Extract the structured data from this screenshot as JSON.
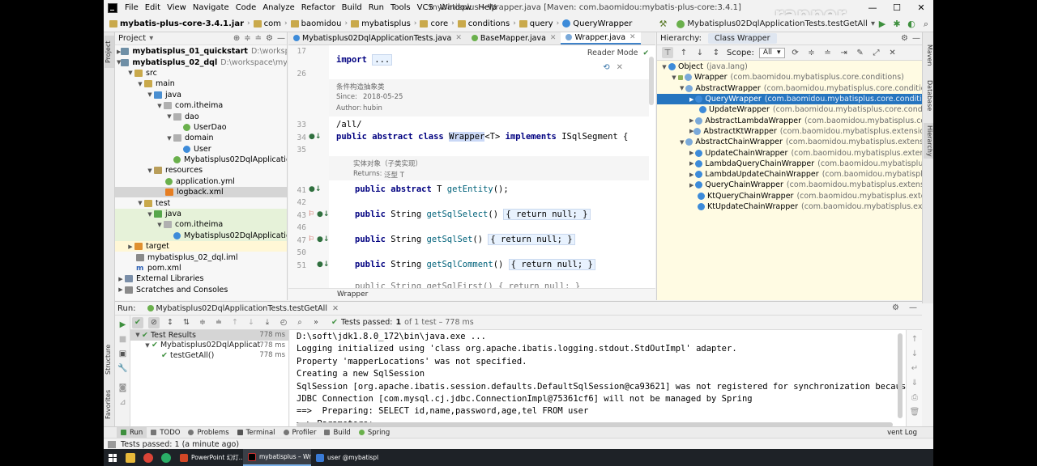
{
  "window": {
    "title": "mybatisplus – Wrapper.java [Maven: com.baomidou:mybatis-plus-core:3.4.1]",
    "watermark": "rapper"
  },
  "menu": [
    "File",
    "Edit",
    "View",
    "Navigate",
    "Code",
    "Analyze",
    "Refactor",
    "Build",
    "Run",
    "Tools",
    "VCS",
    "Window",
    "Help"
  ],
  "breadcrumbs": [
    "mybatis-plus-core-3.4.1.jar",
    "com",
    "baomidou",
    "mybatisplus",
    "core",
    "conditions",
    "query",
    "QueryWrapper"
  ],
  "run_config": "Mybatisplus02DqlApplicationTests.testGetAll",
  "project": {
    "title": "Project",
    "rows": [
      {
        "label": "mybatisplus_01_quickstart",
        "path": "D:\\workspace\\m",
        "bold": true
      },
      {
        "label": "mybatisplus_02_dql",
        "path": "D:\\workspace\\mybatisp",
        "bold": true
      },
      {
        "label": "src"
      },
      {
        "label": "main"
      },
      {
        "label": "java"
      },
      {
        "label": "com.itheima"
      },
      {
        "label": "dao"
      },
      {
        "label": "UserDao"
      },
      {
        "label": "domain"
      },
      {
        "label": "User"
      },
      {
        "label": "Mybatisplus02DqlApplication"
      },
      {
        "label": "resources"
      },
      {
        "label": "application.yml"
      },
      {
        "label": "logback.xml"
      },
      {
        "label": "test"
      },
      {
        "label": "java"
      },
      {
        "label": "com.itheima"
      },
      {
        "label": "Mybatisplus02DqlApplicationTe"
      },
      {
        "label": "target"
      },
      {
        "label": "mybatisplus_02_dql.iml"
      },
      {
        "label": "pom.xml"
      },
      {
        "label": "External Libraries"
      },
      {
        "label": "Scratches and Consoles"
      }
    ]
  },
  "editor": {
    "tabs": [
      "Mybatisplus02DqlApplicationTests.java",
      "BaseMapper.java",
      "Wrapper.java"
    ],
    "reader_mode": "Reader Mode",
    "footer": "Wrapper",
    "line_numbers": [
      "17",
      "26",
      "33",
      "34",
      "35",
      "41",
      "42",
      "43",
      "46",
      "47",
      "50",
      "51"
    ],
    "doc": {
      "title": "条件构造抽象类",
      "since_label": "Since:",
      "since": "2018-05-25",
      "author_label": "Author:",
      "author": "hubin",
      "entity_title": "实体对象（子类实现）",
      "returns_label": "Returns:",
      "returns": "泛型 T"
    },
    "code": {
      "import_kw": "import",
      "import_fold": "...",
      "all_comment": "/all/",
      "class_prefix_kw": "public abstract class",
      "class_name": "Wrapper",
      "class_suffix": "<T> ",
      "implements_kw": "implements",
      "class_end": " ISqlSegment {",
      "l41_kw": "public abstract",
      "l41_rest": " T ",
      "l41_fn": "getEntity",
      "l41_end": "();",
      "l43_kw": "public",
      "l43_type": " String ",
      "l43_fn": "getSqlSelect",
      "l43_paren": "() ",
      "l43_fold": "{ return null; }",
      "l47_kw": "public",
      "l47_type": " String ",
      "l47_fn": "getSqlSet",
      "l47_paren": "() ",
      "l47_fold": "{ return null; }",
      "l51_kw": "public",
      "l51_type": " String ",
      "l51_fn": "getSqlComment",
      "l51_paren": "() ",
      "l51_fold": "{ return null; }",
      "l55_partial": "public String getSqlFirst() { return null; }"
    }
  },
  "hierarchy": {
    "title": "Hierarchy:",
    "tab": "Class Wrapper",
    "scope_label": "Scope:",
    "scope_value": "All",
    "rows": [
      {
        "name": "Object",
        "pkg": "(java.lang)"
      },
      {
        "name": "Wrapper",
        "pkg": "(com.baomidou.mybatisplus.core.conditions)"
      },
      {
        "name": "AbstractWrapper",
        "pkg": "(com.baomidou.mybatisplus.core.conditions)"
      },
      {
        "name": "QueryWrapper",
        "pkg": "(com.baomidou.mybatisplus.core.conditions.qu"
      },
      {
        "name": "UpdateWrapper",
        "pkg": "(com.baomidou.mybatisplus.core.conditions.u"
      },
      {
        "name": "AbstractLambdaWrapper",
        "pkg": "(com.baomidou.mybatisplus.core.condit"
      },
      {
        "name": "AbstractKtWrapper",
        "pkg": "(com.baomidou.mybatisplus.extension.kotlin"
      },
      {
        "name": "AbstractChainWrapper",
        "pkg": "(com.baomidou.mybatisplus.extension.co"
      },
      {
        "name": "UpdateChainWrapper",
        "pkg": "(com.baomidou.mybatisplus.extension.c"
      },
      {
        "name": "LambdaQueryChainWrapper",
        "pkg": "(com.baomidou.mybatisplus.exte"
      },
      {
        "name": "LambdaUpdateChainWrapper",
        "pkg": "(com.baomidou.mybatisplus.ext"
      },
      {
        "name": "QueryChainWrapper",
        "pkg": "(com.baomidou.mybatisplus.extension.co"
      },
      {
        "name": "KtQueryChainWrapper",
        "pkg": "(com.baomidou.mybatisplus.extension.ko"
      },
      {
        "name": "KtUpdateChainWrapper",
        "pkg": "(com.baomidou.mybatisplus.extension.k"
      }
    ]
  },
  "run": {
    "label": "Run:",
    "tab": "Mybatisplus02DqlApplicationTests.testGetAll",
    "status_prefix": "Tests passed:",
    "status_count": "1",
    "status_suffix": "of 1 test – 778 ms",
    "tree": [
      {
        "label": "Test Results",
        "time": "778 ms"
      },
      {
        "label": "Mybatisplus02DqlApplicationTe",
        "time": "778 ms"
      },
      {
        "label": "testGetAll()",
        "time": "778 ms"
      }
    ],
    "console": [
      "D:\\soft\\jdk1.8.0_172\\bin\\java.exe ...",
      "Logging initialized using 'class org.apache.ibatis.logging.stdout.StdOutImpl' adapter.",
      "Property 'mapperLocations' was not specified.",
      "Creating a new SqlSession",
      "SqlSession [org.apache.ibatis.session.defaults.DefaultSqlSession@ca93621] was not registered for synchronization because synchro",
      "JDBC Connection [com.mysql.cj.jdbc.ConnectionImpl@75361cf6] will not be managed by Spring",
      "==>  Preparing: SELECT id,name,password,age,tel FROM user",
      "==> Parameters:"
    ]
  },
  "bottom_tabs": [
    "Run",
    "TODO",
    "Problems",
    "Terminal",
    "Profiler",
    "Build",
    "Spring"
  ],
  "event_log": "vent Log",
  "status": "Tests passed: 1 (a minute ago)",
  "left_stripe": [
    "Project",
    "Structure",
    "Favorites"
  ],
  "right_stripe": [
    "Maven",
    "Database",
    "Hierarchy"
  ],
  "taskbar": [
    {
      "label": "PowerPoint 幻灯..."
    },
    {
      "label": "mybatisplus – Wr..."
    },
    {
      "label": "user @mybatispl..."
    }
  ],
  "colors": {
    "accent": "#2675bf",
    "pass_green": "#3d8f3d",
    "keyword": "#000080",
    "hierarchy_bg": "#fffbe3"
  }
}
